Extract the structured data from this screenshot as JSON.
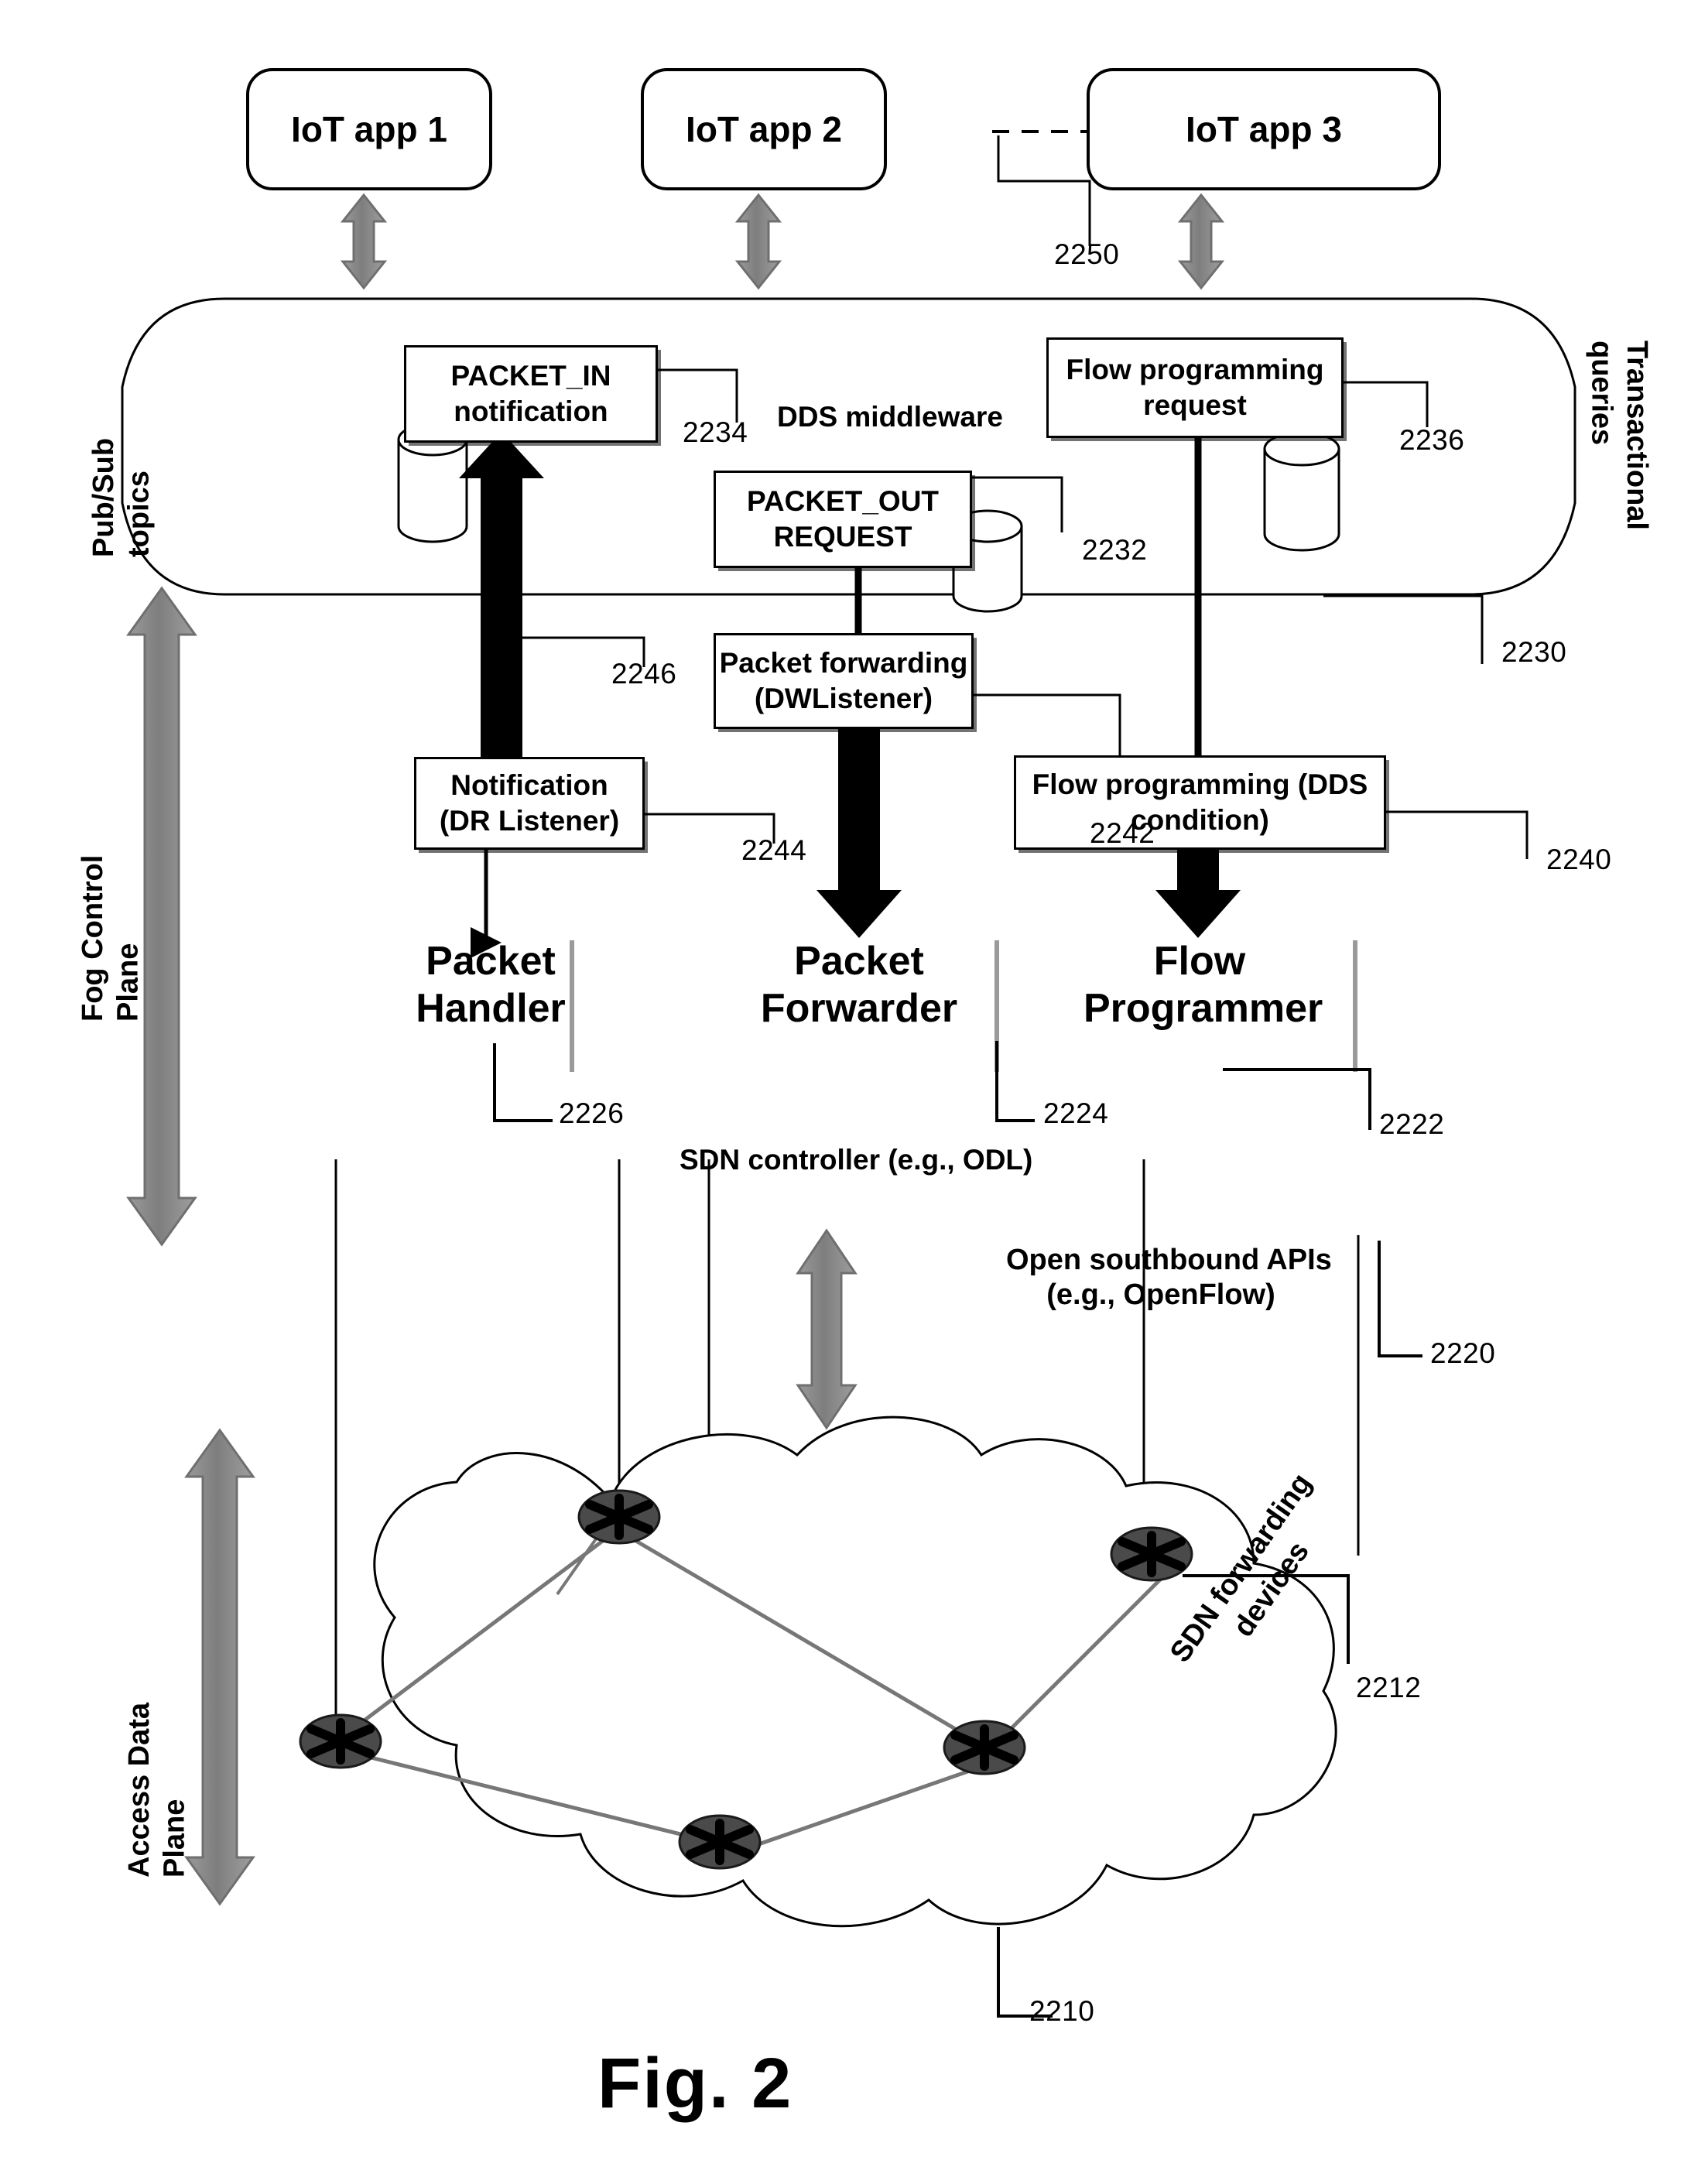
{
  "figure": {
    "caption": "Fig. 2"
  },
  "apps": {
    "items": [
      {
        "label": "IoT app 1"
      },
      {
        "label": "IoT app 2"
      },
      {
        "label": "IoT app 3"
      }
    ],
    "link_ref": "2250"
  },
  "middleware": {
    "name": "DDS middleware",
    "ref": "2230",
    "left_label": "Pub/Sub\ntopics",
    "right_label": "Transactional\nqueries",
    "topics": [
      {
        "label": "PACKET_IN\nnotification",
        "ref": "2234"
      },
      {
        "label": "PACKET_OUT\nREQUEST",
        "ref": "2232"
      },
      {
        "label": "Flow programming\nrequest",
        "ref": "2236"
      }
    ]
  },
  "adapters": [
    {
      "label": "Notification\n(DR Listener)",
      "ref": "2246"
    },
    {
      "label": "Packet forwarding\n(DWListener)",
      "ref": "2244"
    },
    {
      "label": "Flow programming (DDS\ncondition)",
      "ref": "2242"
    }
  ],
  "adapter_refs": {
    "notification": "2246",
    "packet_forwarding": "2244",
    "flow_programming": "2242",
    "group": "2240"
  },
  "controller": {
    "label": "SDN controller (e.g., ODL)",
    "modules": [
      {
        "label": "Packet\nHandler",
        "ref": "2226"
      },
      {
        "label": "Packet\nForwarder",
        "ref": "2224"
      },
      {
        "label": "Flow\nProgrammer",
        "ref": "2222"
      }
    ]
  },
  "southbound": {
    "label": "Open southbound APIs\n(e.g., OpenFlow)",
    "ref": "2220"
  },
  "dataplane": {
    "cloud_label": "SDN forwarding\ndevices",
    "device_ref": "2212",
    "cloud_ref": "2210"
  },
  "planes": {
    "fog_control": "Fog Control\nPlane",
    "access_data": "Access Data\nPlane"
  },
  "colors": {
    "ink": "#000000",
    "gray_arrow": "#8d8d8d",
    "gray_arrow_edge": "#6f6f6f",
    "node_fill": "#3b3b3b"
  }
}
